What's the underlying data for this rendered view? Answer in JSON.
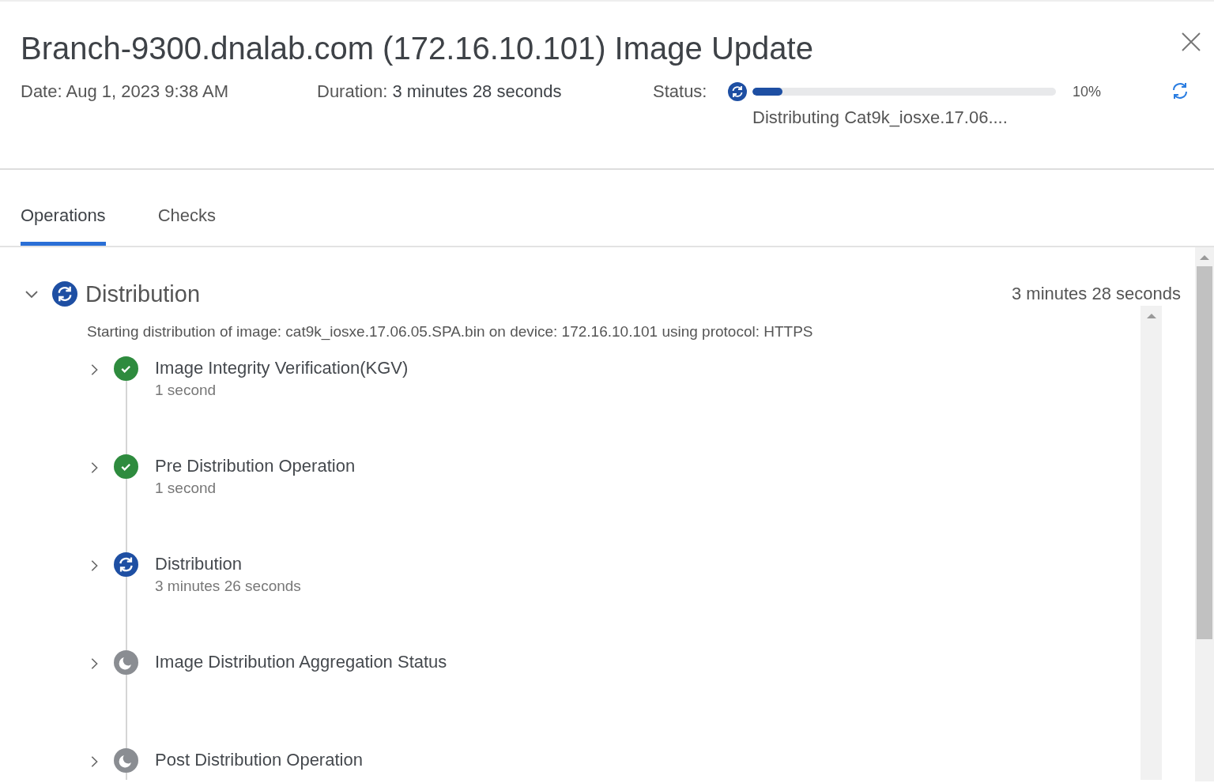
{
  "header": {
    "title": "Branch-9300.dnalab.com (172.16.10.101) Image Update",
    "date_label": "Date:",
    "date": "Aug 1, 2023 9:38 AM",
    "duration_label": "Duration:",
    "duration": "3 minutes 28 seconds",
    "status": {
      "label": "Status:",
      "kind": "running",
      "level": 0.1,
      "percent": "10%",
      "text": "Distributing Cat9k_iosxe.17.06...."
    }
  },
  "tabs": [
    {
      "label": "Operations",
      "selected": true
    },
    {
      "label": "Checks",
      "selected": false
    }
  ],
  "section": {
    "title": "Distribution",
    "kind": "running",
    "expanded": true,
    "duration": "3 minutes 28 seconds",
    "description": "Starting distribution of image: cat9k_iosxe.17.06.05.SPA.bin on device: 172.16.10.101 using protocol: HTTPS",
    "steps": [
      {
        "title": "Image Integrity Verification(KGV)",
        "duration": "1 second",
        "kind": "done",
        "expanded": false
      },
      {
        "title": "Pre Distribution Operation",
        "duration": "1 second",
        "kind": "done",
        "expanded": false
      },
      {
        "title": "Distribution",
        "duration": "3 minutes 26 seconds",
        "kind": "running",
        "expanded": false
      },
      {
        "title": "Image Distribution Aggregation Status",
        "kind": "pending",
        "expanded": false
      },
      {
        "title": "Post Distribution Operation",
        "kind": "pending",
        "expanded": false
      }
    ]
  }
}
